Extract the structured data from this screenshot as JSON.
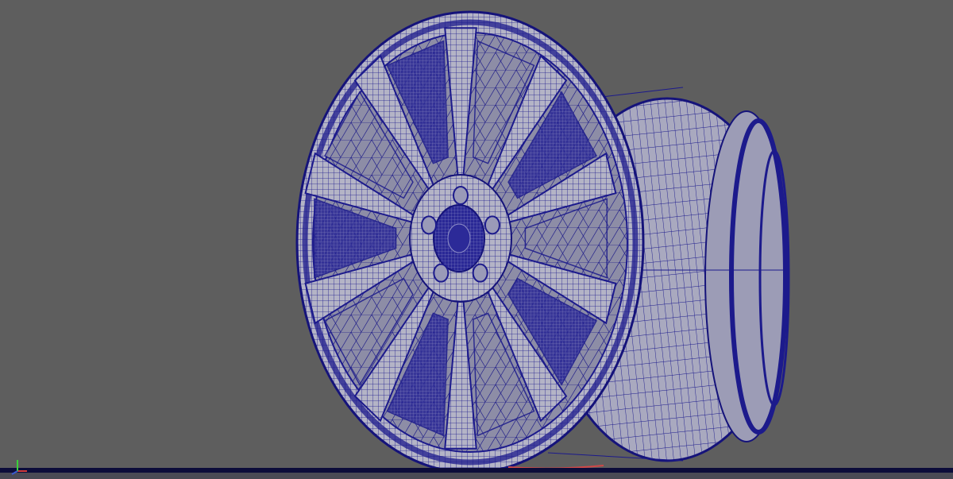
{
  "viewport": {
    "label": "",
    "background_color": "#5e5e5e",
    "wireframe_color": "#1c1a8c",
    "surface_color": "#b9b9c9",
    "spoke_count": 10,
    "lug_nut_count": 5
  },
  "axis_gizmo": {
    "icon": "axis-gizmo-icon",
    "x_color": "#d23a3a",
    "y_color": "#3ad23a",
    "z_color": "#3a5ad2"
  }
}
